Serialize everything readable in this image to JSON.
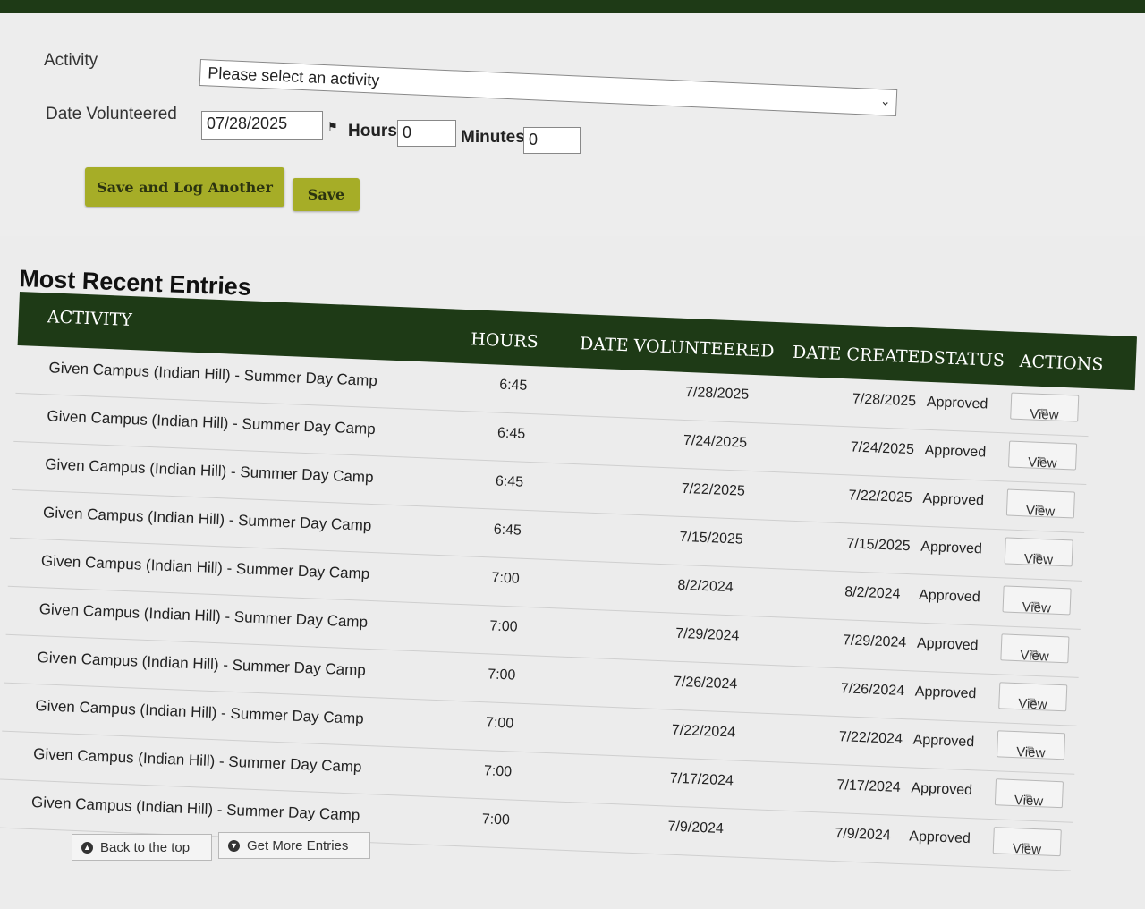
{
  "form": {
    "activity_label": "Activity",
    "activity_value": "Please select an activity",
    "date_label": "Date Volunteered",
    "date_value": "07/28/2025",
    "hours_label": "Hours",
    "hours_value": "0",
    "minutes_label": "Minutes",
    "minutes_value": "0",
    "save_log_label": "Save and Log Another",
    "save_label": "Save"
  },
  "recent": {
    "title": "Most Recent Entries",
    "columns": [
      "ACTIVITY",
      "HOURS",
      "DATE VOLUNTEERED",
      "DATE CREATED",
      "STATUS",
      "ACTIONS"
    ],
    "view_label": "View",
    "rows": [
      {
        "activity": "Given Campus (Indian Hill) - Summer Day Camp",
        "hours": "6:45",
        "date_volunteered": "7/28/2025",
        "date_created": "7/28/2025",
        "status": "Approved"
      },
      {
        "activity": "Given Campus (Indian Hill) - Summer Day Camp",
        "hours": "6:45",
        "date_volunteered": "7/24/2025",
        "date_created": "7/24/2025",
        "status": "Approved"
      },
      {
        "activity": "Given Campus (Indian Hill) - Summer Day Camp",
        "hours": "6:45",
        "date_volunteered": "7/22/2025",
        "date_created": "7/22/2025",
        "status": "Approved"
      },
      {
        "activity": "Given Campus (Indian Hill) - Summer Day Camp",
        "hours": "6:45",
        "date_volunteered": "7/15/2025",
        "date_created": "7/15/2025",
        "status": "Approved"
      },
      {
        "activity": "Given Campus (Indian Hill) - Summer Day Camp",
        "hours": "7:00",
        "date_volunteered": "8/2/2024",
        "date_created": "8/2/2024",
        "status": "Approved"
      },
      {
        "activity": "Given Campus (Indian Hill) - Summer Day Camp",
        "hours": "7:00",
        "date_volunteered": "7/29/2024",
        "date_created": "7/29/2024",
        "status": "Approved"
      },
      {
        "activity": "Given Campus (Indian Hill) - Summer Day Camp",
        "hours": "7:00",
        "date_volunteered": "7/26/2024",
        "date_created": "7/26/2024",
        "status": "Approved"
      },
      {
        "activity": "Given Campus (Indian Hill) - Summer Day Camp",
        "hours": "7:00",
        "date_volunteered": "7/22/2024",
        "date_created": "7/22/2024",
        "status": "Approved"
      },
      {
        "activity": "Given Campus (Indian Hill) - Summer Day Camp",
        "hours": "7:00",
        "date_volunteered": "7/17/2024",
        "date_created": "7/17/2024",
        "status": "Approved"
      },
      {
        "activity": "Given Campus (Indian Hill) - Summer Day Camp",
        "hours": "7:00",
        "date_volunteered": "7/9/2024",
        "date_created": "7/9/2024",
        "status": "Approved"
      }
    ]
  },
  "footer": {
    "back_top_label": "Back to the top",
    "more_entries_label": "Get More Entries"
  },
  "icons": {
    "date_picker": "flag-icon",
    "view": "external-link-icon",
    "back_top": "arrow-up-circle-icon",
    "more": "arrow-down-circle-icon"
  }
}
